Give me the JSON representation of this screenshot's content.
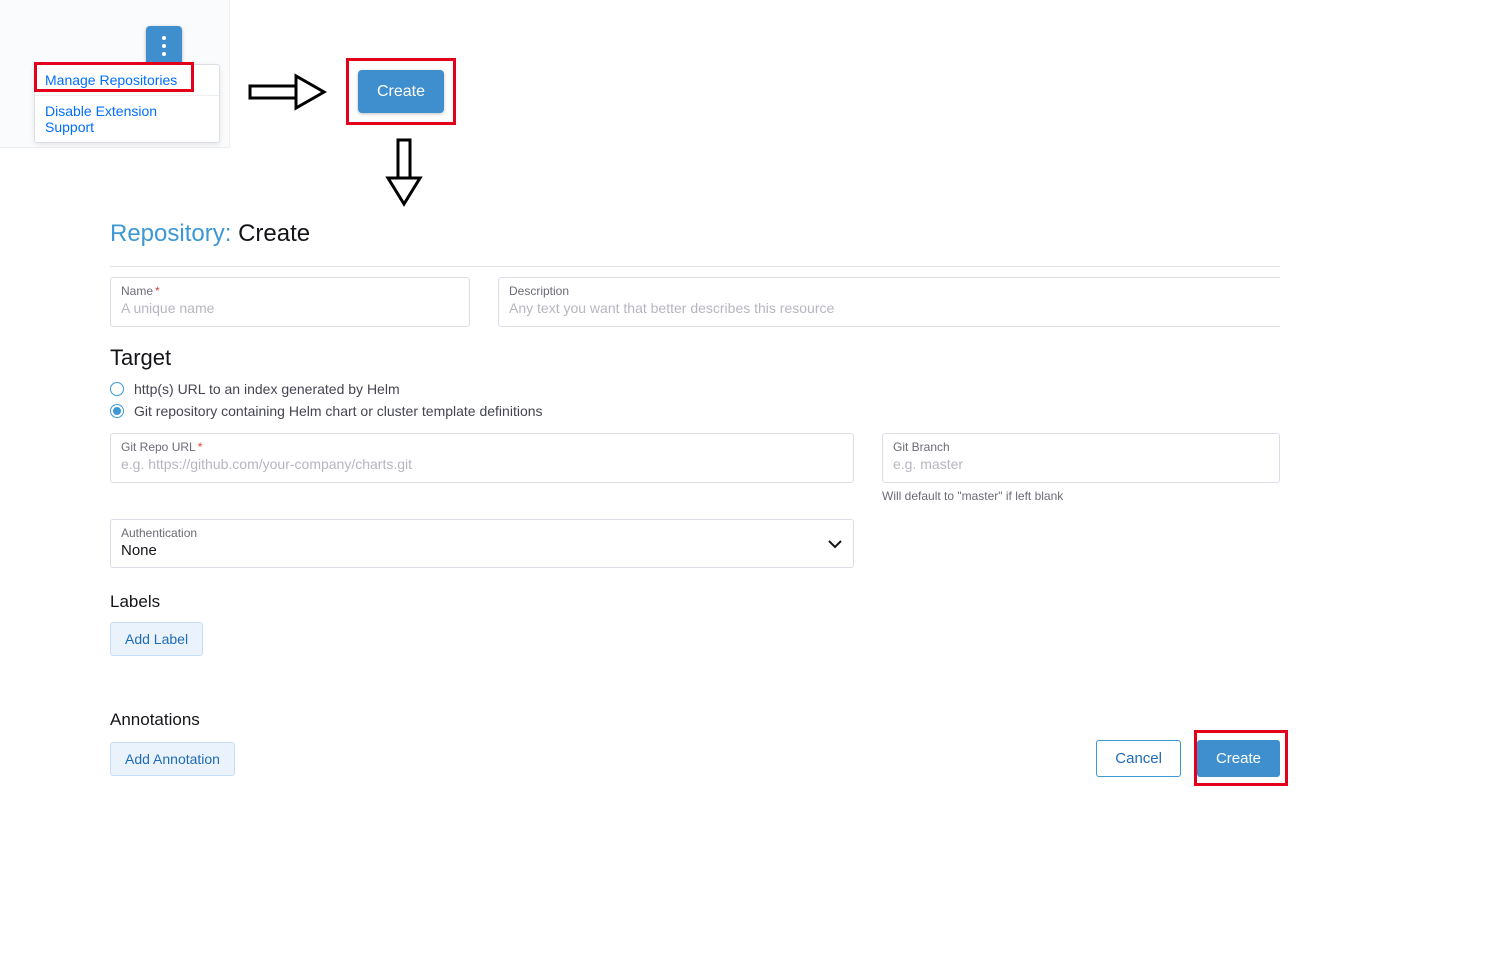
{
  "menu": {
    "item1": "Manage Repositories",
    "item2": "Disable Extension Support"
  },
  "create_button_top": "Create",
  "page_title_prefix": "Repository:",
  "page_title_suffix": "Create",
  "fields": {
    "name_label": "Name",
    "name_placeholder": "A unique name",
    "desc_label": "Description",
    "desc_placeholder": "Any text you want that better describes this resource",
    "git_url_label": "Git Repo URL",
    "git_url_placeholder": "e.g. https://github.com/your-company/charts.git",
    "git_branch_label": "Git Branch",
    "git_branch_placeholder": "e.g. master",
    "git_branch_hint": "Will default to \"master\" if left blank",
    "auth_label": "Authentication",
    "auth_value": "None"
  },
  "target": {
    "heading": "Target",
    "option_http": "http(s) URL to an index generated by Helm",
    "option_git": "Git repository containing Helm chart or cluster template definitions"
  },
  "labels_heading": "Labels",
  "add_label_btn": "Add Label",
  "annotations_heading": "Annotations",
  "add_annotation_btn": "Add Annotation",
  "footer": {
    "cancel": "Cancel",
    "create": "Create"
  }
}
